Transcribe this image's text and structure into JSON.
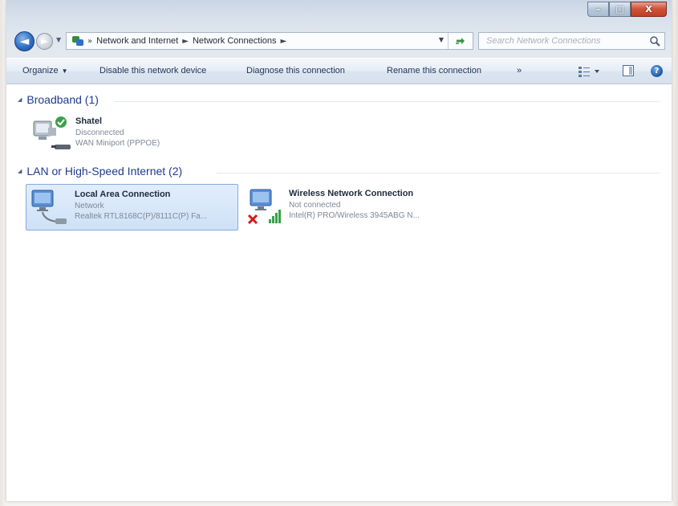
{
  "window": {
    "caption": {
      "minimize": "–",
      "maximize": "□",
      "close": "X"
    }
  },
  "nav": {
    "back_icon": "back-arrow-icon",
    "forward_icon": "forward-arrow-icon",
    "breadcrumb": {
      "overflow": "»",
      "items": [
        "Network and Internet",
        "Network Connections"
      ],
      "separator": "►"
    },
    "search": {
      "placeholder": "Search Network Connections"
    }
  },
  "commandbar": {
    "organize": "Organize",
    "disable": "Disable this network device",
    "diagnose": "Diagnose this connection",
    "rename": "Rename this connection",
    "more": "»"
  },
  "groups": [
    {
      "header": "Broadband (1)",
      "items": [
        {
          "name": "Shatel",
          "status": "Disconnected",
          "device": "WAN Miniport (PPPOE)",
          "badge": "connected-check-icon"
        }
      ]
    },
    {
      "header": "LAN or High-Speed Internet (2)",
      "items": [
        {
          "name": "Local Area Connection",
          "status": "Network",
          "device": "Realtek RTL8168C(P)/8111C(P) Fa...",
          "selected": true
        },
        {
          "name": "Wireless Network Connection",
          "status": "Not connected",
          "device": "Intel(R) PRO/Wireless 3945ABG N...",
          "badge": "disconnected-x-icon"
        }
      ]
    }
  ],
  "colors": {
    "accent": "#1e3b8f",
    "selection": "#cfe1f8",
    "selection_border": "#84acdd",
    "status_ok": "#3aa14a",
    "status_error": "#d21a1a"
  }
}
